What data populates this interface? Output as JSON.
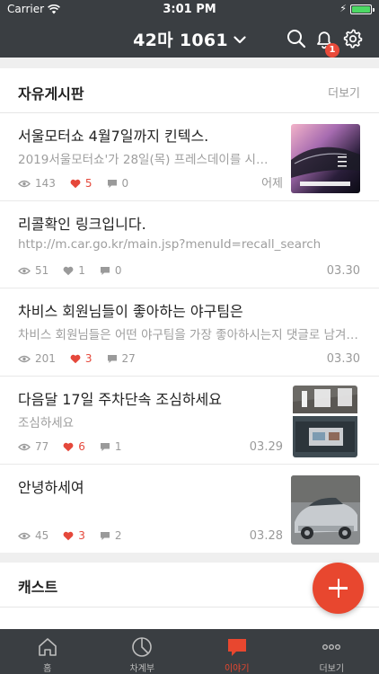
{
  "status_bar": {
    "carrier": "Carrier",
    "time": "3:01 PM"
  },
  "header": {
    "car_number": "42마 1061",
    "notification_count": "1"
  },
  "colors": {
    "accent": "#e8472f",
    "header_bg": "#3a3e42",
    "like_red": "#e5483b"
  },
  "board": {
    "title": "자유게시판",
    "more_label": "더보기",
    "posts": [
      {
        "title": "서울모터쇼 4월7일까지 킨텍스.",
        "excerpt": "2019서울모터쇼'가 28일(목) 프레스데이를 시작…",
        "views": "143",
        "likes": "5",
        "comments": "0",
        "date": "어제",
        "liked": true,
        "thumb": "motorshow"
      },
      {
        "title": "리콜확인 링크입니다.",
        "excerpt": "http://m.car.go.kr/main.jsp?menuId=recall_search",
        "views": "51",
        "likes": "1",
        "comments": "0",
        "date": "03.30",
        "liked": false
      },
      {
        "title": "차비스 회원님들이 좋아하는 야구팀은",
        "excerpt": "차비스 회원님들은 어떤 야구팀을 가장 좋아하시는지 댓글로 남겨…",
        "views": "201",
        "likes": "3",
        "comments": "27",
        "date": "03.30",
        "liked": true
      },
      {
        "title": "다음달 17일 주차단속 조심하세요",
        "excerpt": "조심하세요",
        "views": "77",
        "likes": "6",
        "comments": "1",
        "date": "03.29",
        "liked": true,
        "thumb": "parking"
      },
      {
        "title": "안녕하세여",
        "excerpt": "",
        "views": "45",
        "likes": "3",
        "comments": "2",
        "date": "03.28",
        "liked": true,
        "thumb": "silver-car"
      }
    ]
  },
  "cast": {
    "title": "캐스트"
  },
  "tabbar": {
    "tabs": [
      {
        "label": "홈",
        "icon": "home-icon",
        "active": false
      },
      {
        "label": "차계부",
        "icon": "chart-pie-icon",
        "active": false
      },
      {
        "label": "이야기",
        "icon": "chat-bubble-icon",
        "active": true
      },
      {
        "label": "더보기",
        "icon": "more-dots-icon",
        "active": false
      }
    ]
  }
}
